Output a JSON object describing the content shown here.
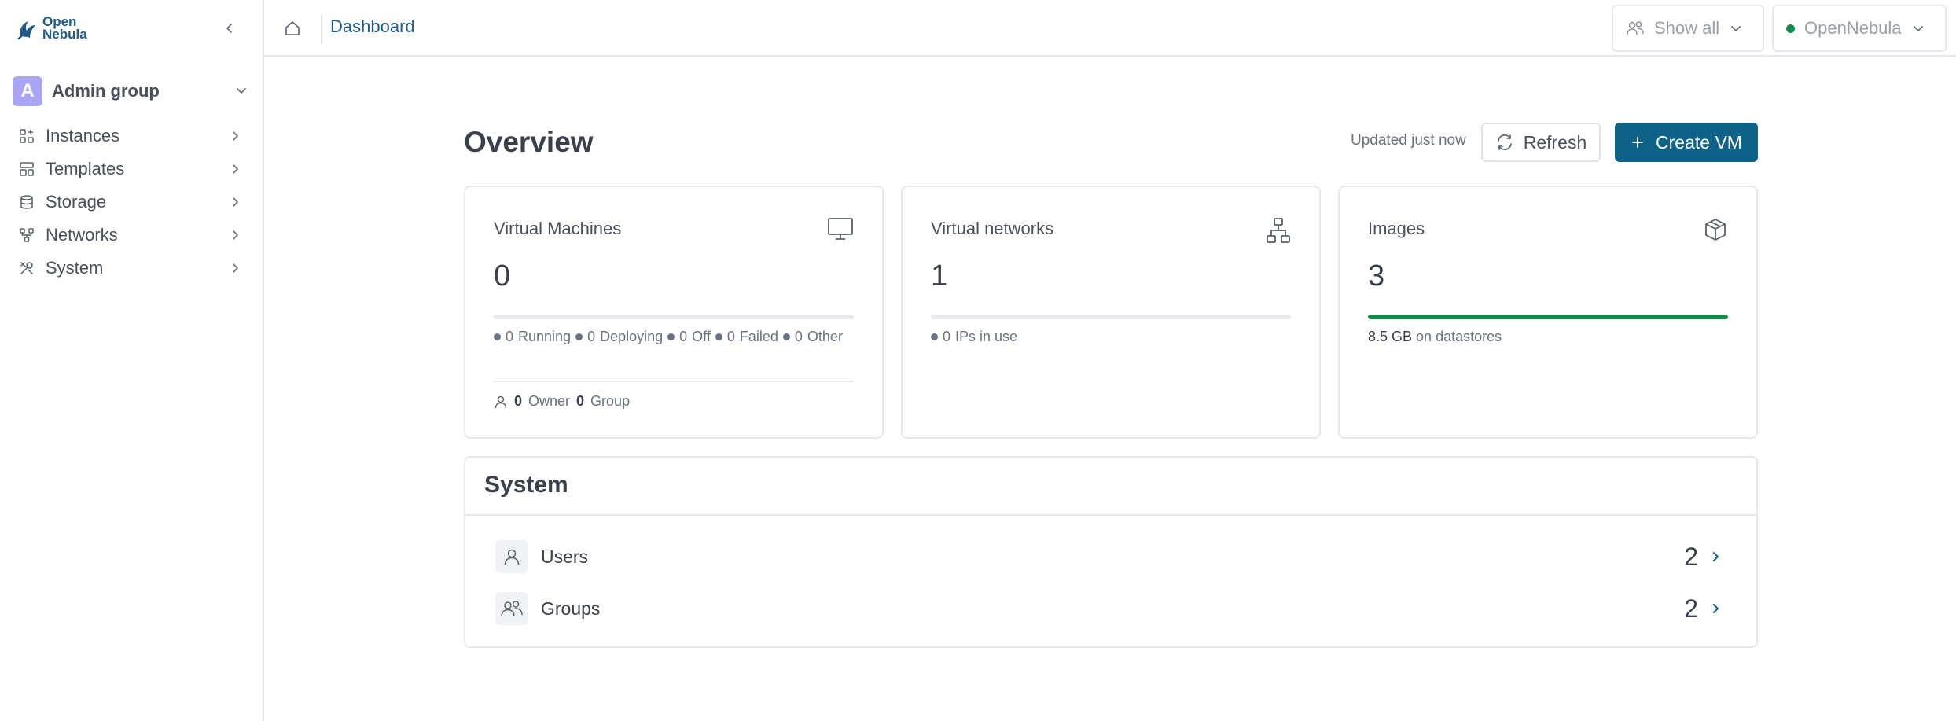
{
  "brand": {
    "line1": "Open",
    "line2": "Nebula",
    "color": "#1f5a8a"
  },
  "sidebar": {
    "group": {
      "avatar": "A",
      "label": "Admin group",
      "avatar_color": "#a8a5f5"
    },
    "items": [
      {
        "label": "Instances",
        "icon": "instances-icon"
      },
      {
        "label": "Templates",
        "icon": "templates-icon"
      },
      {
        "label": "Storage",
        "icon": "storage-icon"
      },
      {
        "label": "Networks",
        "icon": "networks-icon"
      },
      {
        "label": "System",
        "icon": "system-icon"
      }
    ]
  },
  "topbar": {
    "breadcrumb": "Dashboard",
    "filter_label": "Show all",
    "zone_label": "OpenNebula",
    "zone_status_color": "#13894a"
  },
  "overview": {
    "title": "Overview",
    "updated": "Updated just now",
    "refresh_label": "Refresh",
    "create_label": "Create VM",
    "accent": "#0e6287"
  },
  "cards": {
    "vms": {
      "title": "Virtual Machines",
      "value": "0",
      "states": [
        {
          "count": "0",
          "label": "Running"
        },
        {
          "count": "0",
          "label": "Deploying"
        },
        {
          "count": "0",
          "label": "Off"
        },
        {
          "count": "0",
          "label": "Failed"
        },
        {
          "count": "0",
          "label": "Other"
        }
      ],
      "owner_count": "0",
      "owner_label": "Owner",
      "group_count": "0",
      "group_label": "Group"
    },
    "networks": {
      "title": "Virtual networks",
      "value": "1",
      "ips_count": "0",
      "ips_label": "IPs in use",
      "usage_fraction": 0
    },
    "images": {
      "title": "Images",
      "value": "3",
      "size_value": "8.5 GB",
      "size_label": "on datastores",
      "usage_fraction": 1.0,
      "bar_color": "#13894a"
    }
  },
  "system": {
    "title": "System",
    "rows": [
      {
        "label": "Users",
        "count": "2"
      },
      {
        "label": "Groups",
        "count": "2"
      }
    ]
  }
}
